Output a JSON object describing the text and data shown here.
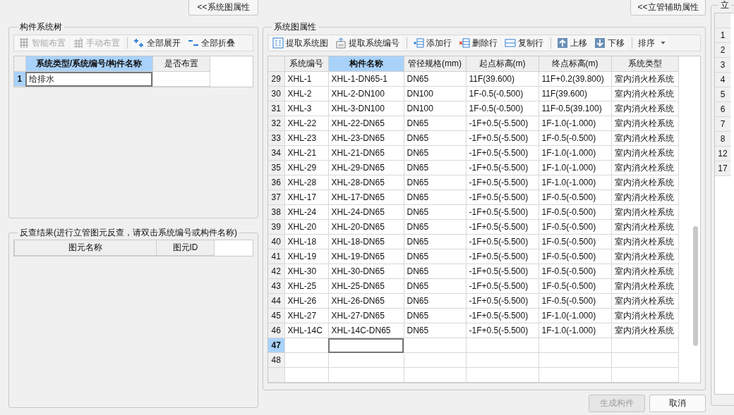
{
  "left_panel": {
    "toggle_button": "<<系统图属性",
    "tree_group": {
      "title": "构件系统树",
      "toolbar": [
        {
          "label": "智能布置",
          "kind": "smart",
          "disabled": true
        },
        {
          "label": "手动布置",
          "kind": "manual",
          "disabled": true
        },
        {
          "label": "全部展开",
          "kind": "expand",
          "disabled": false
        },
        {
          "label": "全部折叠",
          "kind": "collapse",
          "disabled": false
        }
      ],
      "columns": [
        {
          "label": "系统类型/系统编号/构件名称",
          "selected": true
        },
        {
          "label": "是否布置",
          "selected": false
        }
      ],
      "rows": [
        {
          "number": "1",
          "selected": true,
          "cells": [
            "给排水"
          ]
        }
      ]
    },
    "reverse_group": {
      "title": "反查结果(进行立管图元反查，请双击系统编号或构件名称)",
      "columns": [
        "图元名称",
        "图元ID"
      ]
    }
  },
  "main_panel": {
    "toggle_button": "<<立管辅助属性",
    "title": "系统图属性",
    "toolbar": [
      [
        {
          "label": "提取系统图",
          "kind": "extract",
          "dropdown": false
        },
        {
          "label": "提取系统编号",
          "kind": "number",
          "dropdown": false
        }
      ],
      [
        {
          "label": "添加行",
          "kind": "add",
          "dropdown": false
        },
        {
          "label": "删除行",
          "kind": "delete",
          "dropdown": false
        },
        {
          "label": "复制行",
          "kind": "copy",
          "dropdown": false
        }
      ],
      [
        {
          "label": "上移",
          "kind": "up",
          "dropdown": false
        },
        {
          "label": "下移",
          "kind": "down",
          "dropdown": false
        }
      ],
      [
        {
          "label": "排序",
          "kind": "sort",
          "dropdown": true
        }
      ]
    ],
    "columns": [
      {
        "label": "系统编号",
        "selected": false
      },
      {
        "label": "构件名称",
        "selected": true
      },
      {
        "label": "管径规格(mm)",
        "selected": false
      },
      {
        "label": "起点标高(m)",
        "selected": false
      },
      {
        "label": "终点标高(m)",
        "selected": false
      },
      {
        "label": "系统类型",
        "selected": false
      }
    ],
    "rows": [
      {
        "number": "29",
        "selected": false,
        "cells": [
          "XHL-1",
          "XHL-1-DN65-1",
          "DN65",
          "11F(39.600)",
          "11F+0.2(39.800)",
          "室内消火栓系统"
        ]
      },
      {
        "number": "30",
        "selected": false,
        "cells": [
          "XHL-2",
          "XHL-2-DN100",
          "DN100",
          "1F-0.5(-0.500)",
          "11F(39.600)",
          "室内消火栓系统"
        ]
      },
      {
        "number": "31",
        "selected": false,
        "cells": [
          "XHL-3",
          "XHL-3-DN100",
          "DN100",
          "1F-0.5(-0.500)",
          "11F-0.5(39.100)",
          "室内消火栓系统"
        ]
      },
      {
        "number": "32",
        "selected": false,
        "cells": [
          "XHL-22",
          "XHL-22-DN65",
          "DN65",
          "-1F+0.5(-5.500)",
          "1F-1.0(-1.000)",
          "室内消火栓系统"
        ]
      },
      {
        "number": "33",
        "selected": false,
        "cells": [
          "XHL-23",
          "XHL-23-DN65",
          "DN65",
          "-1F+0.5(-5.500)",
          "1F-0.5(-0.500)",
          "室内消火栓系统"
        ]
      },
      {
        "number": "34",
        "selected": false,
        "cells": [
          "XHL-21",
          "XHL-21-DN65",
          "DN65",
          "-1F+0.5(-5.500)",
          "1F-1.0(-1.000)",
          "室内消火栓系统"
        ]
      },
      {
        "number": "35",
        "selected": false,
        "cells": [
          "XHL-29",
          "XHL-29-DN65",
          "DN65",
          "-1F+0.5(-5.500)",
          "1F-1.0(-1.000)",
          "室内消火栓系统"
        ]
      },
      {
        "number": "36",
        "selected": false,
        "cells": [
          "XHL-28",
          "XHL-28-DN65",
          "DN65",
          "-1F+0.5(-5.500)",
          "1F-1.0(-1.000)",
          "室内消火栓系统"
        ]
      },
      {
        "number": "37",
        "selected": false,
        "cells": [
          "XHL-17",
          "XHL-17-DN65",
          "DN65",
          "-1F+0.5(-5.500)",
          "1F-0.5(-0.500)",
          "室内消火栓系统"
        ]
      },
      {
        "number": "38",
        "selected": false,
        "cells": [
          "XHL-24",
          "XHL-24-DN65",
          "DN65",
          "-1F+0.5(-5.500)",
          "1F-0.5(-0.500)",
          "室内消火栓系统"
        ]
      },
      {
        "number": "39",
        "selected": false,
        "cells": [
          "XHL-20",
          "XHL-20-DN65",
          "DN65",
          "-1F+0.5(-5.500)",
          "1F-0.5(-0.500)",
          "室内消火栓系统"
        ]
      },
      {
        "number": "40",
        "selected": false,
        "cells": [
          "XHL-18",
          "XHL-18-DN65",
          "DN65",
          "-1F+0.5(-5.500)",
          "1F-0.5(-0.500)",
          "室内消火栓系统"
        ]
      },
      {
        "number": "41",
        "selected": false,
        "cells": [
          "XHL-19",
          "XHL-19-DN65",
          "DN65",
          "-1F+0.5(-5.500)",
          "1F-0.5(-0.500)",
          "室内消火栓系统"
        ]
      },
      {
        "number": "42",
        "selected": false,
        "cells": [
          "XHL-30",
          "XHL-30-DN65",
          "DN65",
          "-1F+0.5(-5.500)",
          "1F-0.5(-0.500)",
          "室内消火栓系统"
        ]
      },
      {
        "number": "43",
        "selected": false,
        "cells": [
          "XHL-25",
          "XHL-25-DN65",
          "DN65",
          "-1F+0.5(-5.500)",
          "1F-0.5(-0.500)",
          "室内消火栓系统"
        ]
      },
      {
        "number": "44",
        "selected": false,
        "cells": [
          "XHL-26",
          "XHL-26-DN65",
          "DN65",
          "-1F+0.5(-5.500)",
          "1F-0.5(-0.500)",
          "室内消火栓系统"
        ]
      },
      {
        "number": "45",
        "selected": false,
        "cells": [
          "XHL-27",
          "XHL-27-DN65",
          "DN65",
          "-1F+0.5(-5.500)",
          "1F-1.0(-1.000)",
          "室内消火栓系统"
        ]
      },
      {
        "number": "46",
        "selected": false,
        "cells": [
          "XHL-14C",
          "XHL-14C-DN65",
          "DN65",
          "-1F+0.5(-5.500)",
          "1F-1.0(-1.000)",
          "室内消火栓系统"
        ]
      },
      {
        "number": "47",
        "selected": true
      },
      {
        "number": "48",
        "selected": false
      }
    ]
  },
  "buttons": [
    {
      "label": "生成构件",
      "disabled": true
    },
    {
      "label": "取消",
      "disabled": false
    }
  ],
  "right_panel": {
    "title": "立",
    "row_numbers": [
      "1",
      "2",
      "3",
      "4",
      "5",
      "6",
      "7",
      "8",
      "12",
      "17"
    ]
  }
}
